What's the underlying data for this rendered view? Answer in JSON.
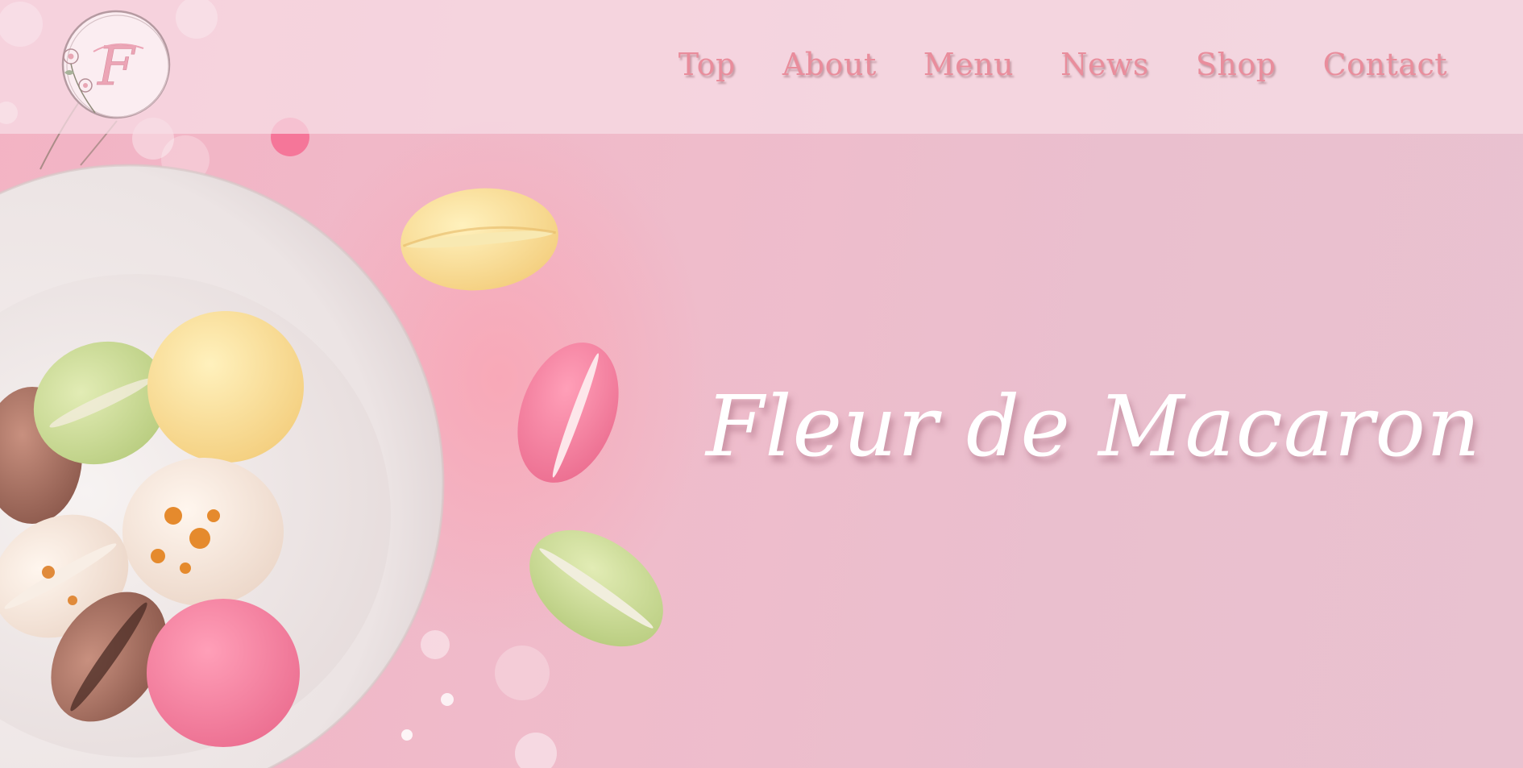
{
  "logo": {
    "letter": "F"
  },
  "nav": {
    "items": [
      {
        "label": "Top"
      },
      {
        "label": "About"
      },
      {
        "label": "Menu"
      },
      {
        "label": "News"
      },
      {
        "label": "Shop"
      },
      {
        "label": "Contact"
      }
    ]
  },
  "hero": {
    "title": "Fleur de Macaron"
  },
  "colors": {
    "nav_text": "#e98d9c",
    "background_pink": "#ecbccb",
    "header_overlay": "#f6dee6",
    "title_text": "#ffffff"
  }
}
